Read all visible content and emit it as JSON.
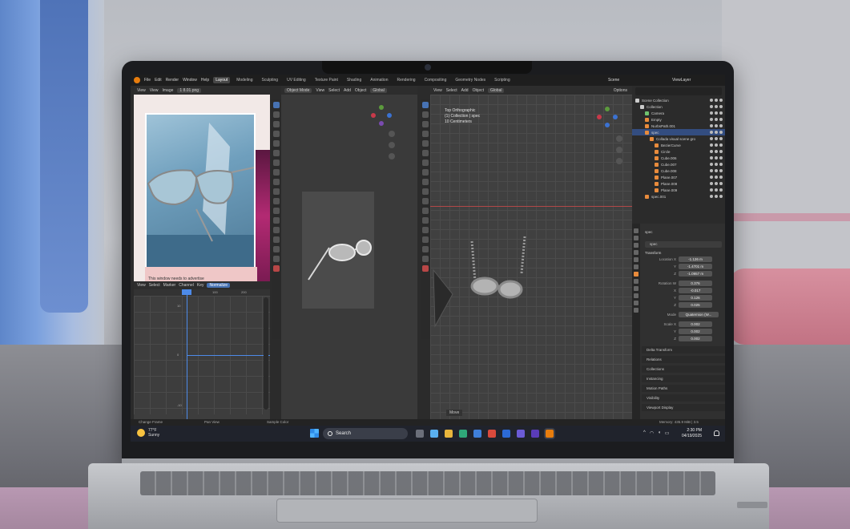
{
  "menubar": {
    "menus": [
      "File",
      "Edit",
      "Render",
      "Window",
      "Help"
    ],
    "workspaces": [
      "Layout",
      "Modeling",
      "Sculpting",
      "UV Editing",
      "Texture Paint",
      "Shading",
      "Animation",
      "Rendering",
      "Compositing",
      "Geometry Nodes",
      "Scripting"
    ],
    "active_workspace": "Layout",
    "scene": "Scene",
    "view_layer": "ViewLayer"
  },
  "image_editor": {
    "menus": [
      "View",
      "View",
      "Image"
    ],
    "filename": "1 8.01.png",
    "caption": "This window needs to advertise"
  },
  "graph_editor": {
    "menus": [
      "View",
      "Select",
      "Marker",
      "Channel",
      "Key"
    ],
    "mode": "Normalize",
    "ruler": [
      "0",
      "100",
      "200"
    ],
    "yticks": [
      "10",
      "0",
      "-10"
    ]
  },
  "viewport_left": {
    "mode": "Object Mode",
    "menus": [
      "View",
      "Select",
      "Add",
      "Object"
    ],
    "orientation": "Global"
  },
  "viewport_right": {
    "menus": [
      "View",
      "Select",
      "Add",
      "Object"
    ],
    "orientation": "Global",
    "info_lines": [
      "Top Orthographic",
      "(1) Collection | spec",
      "10 Centimeters"
    ],
    "options_label": "Options",
    "footer": "Move"
  },
  "outliner": {
    "items": [
      {
        "label": "Scene Collection",
        "depth": 0,
        "color": "#cccccc"
      },
      {
        "label": "Collection",
        "depth": 1,
        "color": "#cccccc"
      },
      {
        "label": "Camera",
        "depth": 2,
        "color": "#6fc36f"
      },
      {
        "label": "Empty",
        "depth": 2,
        "color": "#e88b3c"
      },
      {
        "label": "NurbsPath.001",
        "depth": 2,
        "color": "#e88b3c"
      },
      {
        "label": "spec",
        "depth": 2,
        "color": "#e88b3c",
        "selected": true
      },
      {
        "label": "Collada visual scene gro",
        "depth": 3,
        "color": "#e88b3c"
      },
      {
        "label": "BezierCurve",
        "depth": 4,
        "color": "#e88b3c"
      },
      {
        "label": "Circle",
        "depth": 4,
        "color": "#e88b3c"
      },
      {
        "label": "Cube.006",
        "depth": 4,
        "color": "#e88b3c"
      },
      {
        "label": "Cube.007",
        "depth": 4,
        "color": "#e88b3c"
      },
      {
        "label": "Cube.008",
        "depth": 4,
        "color": "#e88b3c"
      },
      {
        "label": "Plane.007",
        "depth": 4,
        "color": "#e88b3c"
      },
      {
        "label": "Plane.008",
        "depth": 4,
        "color": "#e88b3c"
      },
      {
        "label": "Plane.009",
        "depth": 4,
        "color": "#e88b3c"
      },
      {
        "label": "spec.001",
        "depth": 2,
        "color": "#e88b3c"
      }
    ]
  },
  "properties": {
    "object_name": "spec",
    "header_name": "spec",
    "transform_label": "Transform",
    "rows": [
      {
        "label": "Location X",
        "value": "-1.126 m"
      },
      {
        "label": "Y",
        "value": "-1.4701 m"
      },
      {
        "label": "Z",
        "value": "-1.0957 m"
      },
      {
        "label": "Rotation W",
        "value": "0.376"
      },
      {
        "label": "X",
        "value": "-0.017"
      },
      {
        "label": "Y",
        "value": "0.126"
      },
      {
        "label": "Z",
        "value": "0.025"
      },
      {
        "label": "Mode",
        "value": "Quaternion (W..."
      },
      {
        "label": "Scale X",
        "value": "0.002"
      },
      {
        "label": "Y",
        "value": "0.002"
      },
      {
        "label": "Z",
        "value": "0.002"
      }
    ],
    "panels": [
      "Delta Transform",
      "Relations",
      "Collections",
      "Instancing",
      "Motion Paths",
      "Visibility",
      "Viewport Display"
    ]
  },
  "statusbar": {
    "left": "Change Frame",
    "mid1": "Pan View",
    "mid2": "Sample Color",
    "right": "Memory: 435.9 MiB | 3.5"
  },
  "taskbar": {
    "temperature": "77°F",
    "condition": "Sunny",
    "search_label": "Search",
    "time": "2:30 PM",
    "date": "04/19/2025",
    "tray": [
      "^",
      "wifi",
      "vol",
      "bat"
    ]
  },
  "colors": {
    "accent_blue": "#4772b3",
    "blender_orange": "#e87d0d"
  }
}
